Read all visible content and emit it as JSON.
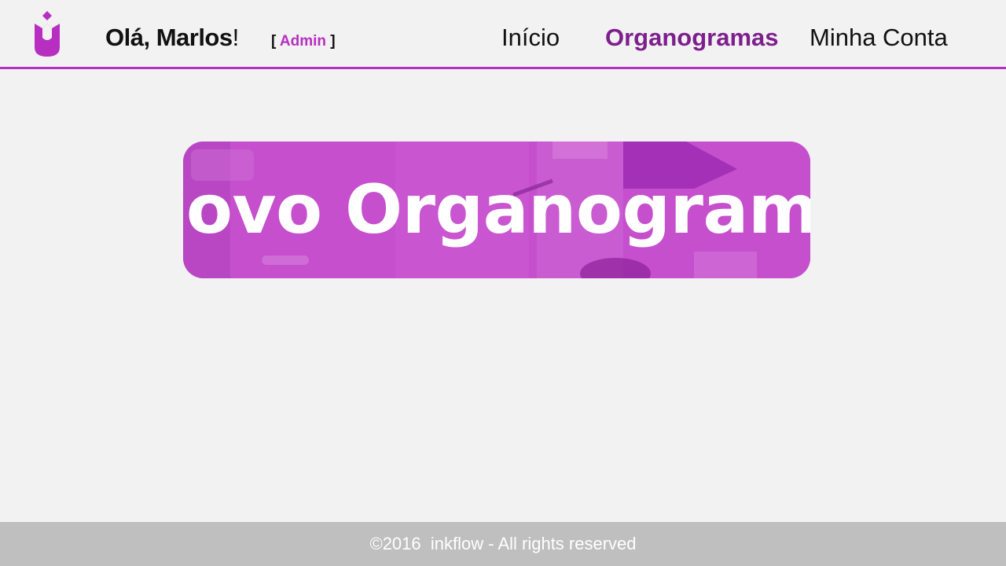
{
  "header": {
    "logo_icon": "tulip-logo-icon",
    "greeting": "Olá, Marlos",
    "greeting_punct": "!",
    "role_open": "[ ",
    "role": "Admin",
    "role_close": " ]"
  },
  "nav": {
    "items": [
      {
        "label": "Início",
        "active": false
      },
      {
        "label": "Organogramas",
        "active": true
      },
      {
        "label": "Minha Conta",
        "active": false
      }
    ]
  },
  "main": {
    "hero_button_label": "Novo Organograma"
  },
  "footer": {
    "text": "©2016  inkflow - All rights reserved"
  },
  "colors": {
    "accent": "#b62fc1",
    "nav_active": "#7d1f8c",
    "hero_overlay": "#c34acc",
    "background": "#f2f2f2",
    "footer_bg": "#bfbfbf"
  }
}
